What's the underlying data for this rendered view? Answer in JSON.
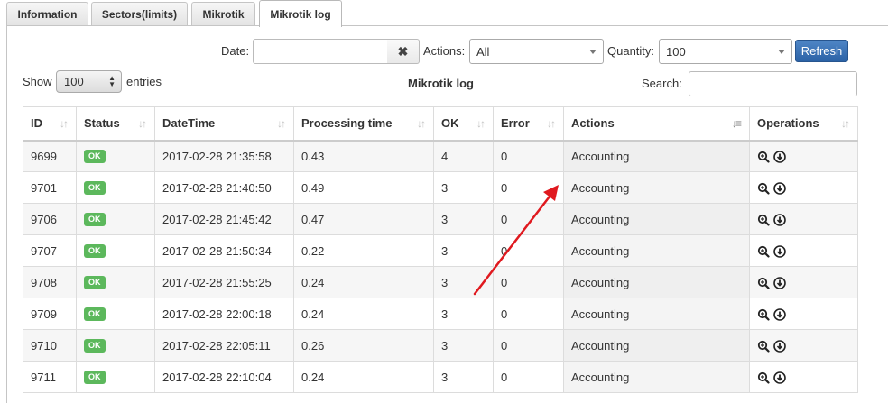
{
  "tabs": [
    {
      "label": "Information",
      "active": false
    },
    {
      "label": "Sectors(limits)",
      "active": false
    },
    {
      "label": "Mikrotik",
      "active": false
    },
    {
      "label": "Mikrotik log",
      "active": true
    }
  ],
  "filters": {
    "date_label": "Date:",
    "date_value": "",
    "actions_label": "Actions:",
    "actions_value": "All",
    "quantity_label": "Quantity:",
    "quantity_value": "100",
    "refresh_label": "Refresh"
  },
  "table_controls": {
    "show_label": "Show",
    "show_value": "100",
    "entries_label": "entries",
    "title": "Mikrotik log",
    "search_label": "Search:",
    "search_value": ""
  },
  "columns": [
    "ID",
    "Status",
    "DateTime",
    "Processing time",
    "OK",
    "Error",
    "Actions",
    "Operations"
  ],
  "rows": [
    {
      "id": "9699",
      "status": "OK",
      "datetime": "2017-02-28 21:35:58",
      "processing": "0.43",
      "ok": "4",
      "error": "0",
      "action": "Accounting"
    },
    {
      "id": "9701",
      "status": "OK",
      "datetime": "2017-02-28 21:40:50",
      "processing": "0.49",
      "ok": "3",
      "error": "0",
      "action": "Accounting"
    },
    {
      "id": "9706",
      "status": "OK",
      "datetime": "2017-02-28 21:45:42",
      "processing": "0.47",
      "ok": "3",
      "error": "0",
      "action": "Accounting"
    },
    {
      "id": "9707",
      "status": "OK",
      "datetime": "2017-02-28 21:50:34",
      "processing": "0.22",
      "ok": "3",
      "error": "0",
      "action": "Accounting"
    },
    {
      "id": "9708",
      "status": "OK",
      "datetime": "2017-02-28 21:55:25",
      "processing": "0.24",
      "ok": "3",
      "error": "0",
      "action": "Accounting"
    },
    {
      "id": "9709",
      "status": "OK",
      "datetime": "2017-02-28 22:00:18",
      "processing": "0.24",
      "ok": "3",
      "error": "0",
      "action": "Accounting"
    },
    {
      "id": "9710",
      "status": "OK",
      "datetime": "2017-02-28 22:05:11",
      "processing": "0.26",
      "ok": "3",
      "error": "0",
      "action": "Accounting"
    },
    {
      "id": "9711",
      "status": "OK",
      "datetime": "2017-02-28 22:10:04",
      "processing": "0.24",
      "ok": "3",
      "error": "0",
      "action": "Accounting"
    }
  ],
  "colors": {
    "ok_badge": "#5cb85c",
    "refresh_button": "#2b62a6",
    "annotation_arrow": "#e0191f"
  },
  "icons": {
    "clear": "times-icon",
    "sort": "sort-icon",
    "sort_active": "sort-desc-icon",
    "view": "zoom-icon",
    "download": "download-icon"
  }
}
